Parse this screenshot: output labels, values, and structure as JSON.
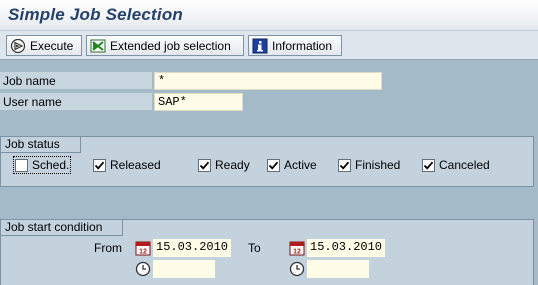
{
  "window": {
    "title": "Simple Job Selection"
  },
  "toolbar": {
    "execute_label": "Execute",
    "extended_label": "Extended job selection",
    "info_label": "Information"
  },
  "fields": {
    "job_name_label": "Job name",
    "job_name_value": "*",
    "user_name_label": "User name",
    "user_name_value": "SAP*"
  },
  "job_status": {
    "title": "Job status",
    "items": [
      {
        "label": "Sched.",
        "checked": false
      },
      {
        "label": "Released",
        "checked": true
      },
      {
        "label": "Ready",
        "checked": true
      },
      {
        "label": "Active",
        "checked": true
      },
      {
        "label": "Finished",
        "checked": true
      },
      {
        "label": "Canceled",
        "checked": true
      }
    ]
  },
  "start_condition": {
    "title": "Job start condition",
    "from_label": "From",
    "to_label": "To",
    "from_date": "15.03.2010",
    "to_date": "15.03.2010",
    "from_time": "",
    "to_time": ""
  },
  "colors": {
    "background": "#a4bac8",
    "title_text": "#26416b",
    "input_bg": "#fffde8"
  }
}
